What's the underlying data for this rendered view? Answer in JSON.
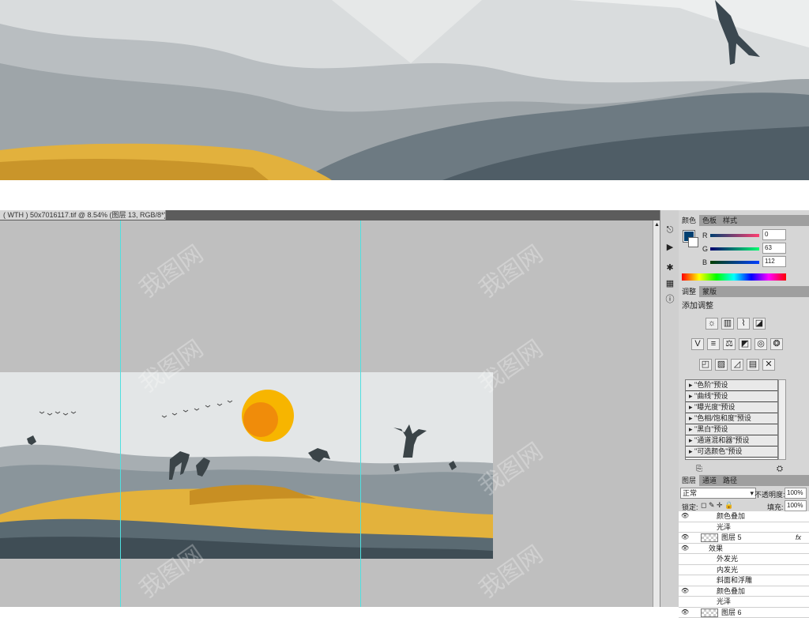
{
  "document": {
    "tab_title": "( WTH ) 50x7016117.tif @ 8.54% (图层 13, RGB/8*)",
    "tab_close": "×"
  },
  "color_panel": {
    "tabs": [
      "颜色",
      "色板",
      "样式"
    ],
    "channels": [
      {
        "label": "R",
        "value": "0"
      },
      {
        "label": "G",
        "value": "63"
      },
      {
        "label": "B",
        "value": "112"
      }
    ],
    "foreground_color": "#003f70"
  },
  "adjustments_panel": {
    "tabs": [
      "调整",
      "蒙版"
    ],
    "heading": "添加调整",
    "presets": [
      "\"色阶\"预设",
      "\"曲线\"预设",
      "\"曝光度\"预设",
      "\"色相/饱和度\"预设",
      "\"黑白\"预设",
      "\"通道混和器\"预设",
      "\"可选颜色\"预设"
    ]
  },
  "layers_panel": {
    "tabs": [
      "图层",
      "通道",
      "路径"
    ],
    "blend_mode": "正常",
    "opacity_label": "不透明度:",
    "opacity_value": "100%",
    "lock_label": "锁定:",
    "fill_label": "填充:",
    "fill_value": "100%",
    "rows": [
      {
        "indent": 3,
        "text": "颜色叠加",
        "eye": true
      },
      {
        "indent": 3,
        "text": "光泽",
        "eye": false
      },
      {
        "indent": 1,
        "text": "图层 5",
        "eye": true,
        "thumb": true,
        "fx": "fx"
      },
      {
        "indent": 2,
        "text": "效果",
        "eye": true
      },
      {
        "indent": 3,
        "text": "外发光",
        "eye": false
      },
      {
        "indent": 3,
        "text": "内发光",
        "eye": false
      },
      {
        "indent": 3,
        "text": "斜面和浮雕",
        "eye": false
      },
      {
        "indent": 3,
        "text": "颜色叠加",
        "eye": true
      },
      {
        "indent": 3,
        "text": "光泽",
        "eye": false
      },
      {
        "indent": 1,
        "text": "图层 6",
        "eye": true,
        "thumb": true
      }
    ]
  },
  "watermark": "我图网"
}
